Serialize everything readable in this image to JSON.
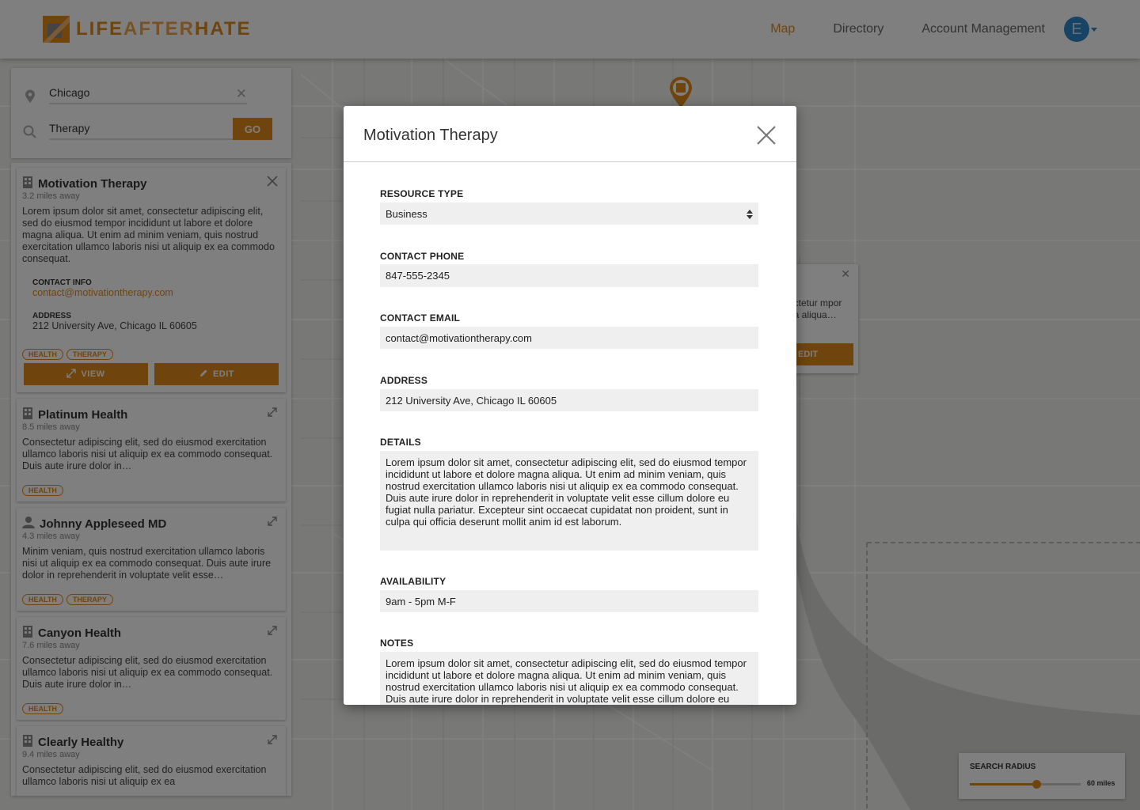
{
  "app": {
    "logo": {
      "part1": "LIFE",
      "part2": "AFTER",
      "part3": "HATE"
    },
    "colors": {
      "accent": "#e08a1a",
      "avatar": "#2f86c9"
    }
  },
  "nav": {
    "items": [
      {
        "label": "Map",
        "active": true
      },
      {
        "label": "Directory",
        "active": false
      },
      {
        "label": "Account Management",
        "active": false
      }
    ],
    "avatar_initial": "E"
  },
  "search": {
    "location_value": "Chicago",
    "query_value": "Therapy",
    "go_label": "GO",
    "clear_glyph": "✕"
  },
  "results": [
    {
      "title": "Motivation Therapy",
      "icon": "building-icon",
      "distance": "3.2 miles away",
      "description": "Lorem ipsum dolor sit amet, consectetur adipiscing elit, sed do eiusmod tempor incididunt ut labore et dolore magna aliqua. Ut enim ad minim veniam, quis nostrud exercitation ullamco laboris nisi ut aliquip ex ea commodo consequat.",
      "contact_label": "CONTACT INFO",
      "contact_email": "contact@motivationtherapy.com",
      "address_label": "ADDRESS",
      "address": "212 University Ave, Chicago IL 60605",
      "tags": [
        "HEALTH",
        "THERAPY"
      ],
      "view_label": "VIEW",
      "edit_label": "EDIT",
      "expanded": true
    },
    {
      "title": "Platinum Health",
      "icon": "building-icon",
      "distance": "8.5 miles away",
      "description": "Consectetur adipiscing elit, sed do eiusmod exercitation ullamco laboris nisi ut aliquip ex ea commodo consequat. Duis aute irure dolor in…",
      "tags": [
        "HEALTH"
      ]
    },
    {
      "title": "Johnny Appleseed MD",
      "icon": "person-icon",
      "distance": "4.3 miles away",
      "description": "Minim veniam, quis nostrud exercitation ullamco laboris nisi ut aliquip ex ea commodo consequat. Duis aute irure dolor in reprehenderit in voluptate velit esse…",
      "tags": [
        "HEALTH",
        "THERAPY"
      ]
    },
    {
      "title": "Canyon Health",
      "icon": "building-icon",
      "distance": "7.6 miles away",
      "description": "Consectetur adipiscing elit, sed do eiusmod exercitation ullamco laboris nisi ut aliquip ex ea commodo consequat. Duis aute irure dolor in…",
      "tags": [
        "HEALTH"
      ]
    },
    {
      "title": "Clearly Healthy",
      "icon": "building-icon",
      "distance": "9.4 miles away",
      "description": "Consectetur adipiscing elit, sed do eiusmod exercitation ullamco laboris nisi ut aliquip ex ea",
      "tags": []
    }
  ],
  "map_popup": {
    "text": "ectetur mpor na aliqua…",
    "edit_label": "EDIT"
  },
  "radius": {
    "label": "SEARCH RADIUS",
    "value_label": "60 miles",
    "fraction": 0.6
  },
  "modal": {
    "title": "Motivation Therapy",
    "fields": {
      "resource_type": {
        "label": "RESOURCE TYPE",
        "value": "Business"
      },
      "contact_phone": {
        "label": "CONTACT PHONE",
        "value": "847-555-2345"
      },
      "contact_email": {
        "label": "CONTACT EMAIL",
        "value": "contact@motivationtherapy.com"
      },
      "address": {
        "label": "ADDRESS",
        "value": "212 University Ave, Chicago IL 60605"
      },
      "details": {
        "label": "DETAILS",
        "value": "Lorem ipsum dolor sit amet, consectetur adipiscing elit, sed do eiusmod tempor incididunt ut labore et dolore magna aliqua. Ut enim ad minim veniam, quis nostrud exercitation ullamco laboris nisi ut aliquip ex ea commodo consequat. Duis aute irure dolor in reprehenderit in voluptate velit esse cillum dolore eu fugiat nulla pariatur. Excepteur sint occaecat cupidatat non proident, sunt in culpa qui officia deserunt mollit anim id est laborum."
      },
      "availability": {
        "label": "AVAILABILITY",
        "value": "9am - 5pm M-F"
      },
      "notes": {
        "label": "NOTES",
        "value": "Lorem ipsum dolor sit amet, consectetur adipiscing elit, sed do eiusmod tempor incididunt ut labore et dolore magna aliqua. Ut enim ad minim veniam, quis nostrud exercitation ullamco laboris nisi ut aliquip ex ea commodo consequat. Duis aute irure dolor in reprehenderit in voluptate velit esse cillum dolore eu"
      }
    }
  }
}
